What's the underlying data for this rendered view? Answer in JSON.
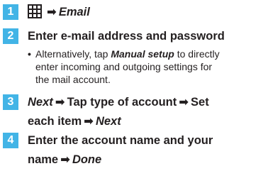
{
  "steps": [
    {
      "number": "1",
      "icon": "apps-grid-icon",
      "arrow": "➡",
      "text": "Email"
    },
    {
      "number": "2",
      "title": "Enter e-mail address and password",
      "bullet_prefix": "Alternatively, tap ",
      "bullet_emph": "Manual setup",
      "bullet_suffix_line1": " to directly",
      "bullet_line2": "enter incoming and outgoing settings for",
      "bullet_line3": "the mail account."
    },
    {
      "number": "3",
      "part1": "Next",
      "arrow1": "➡",
      "part2": "Tap type of account",
      "arrow2": "➡",
      "part3": "Set",
      "line2_part1": "each item",
      "line2_arrow": "➡",
      "line2_part2": "Next"
    },
    {
      "number": "4",
      "line1": "Enter the account name and your",
      "line2_part1": "name",
      "line2_arrow": "➡",
      "line2_part2": "Done"
    }
  ],
  "colors": {
    "badge": "#42b4e6",
    "text": "#231f20"
  }
}
